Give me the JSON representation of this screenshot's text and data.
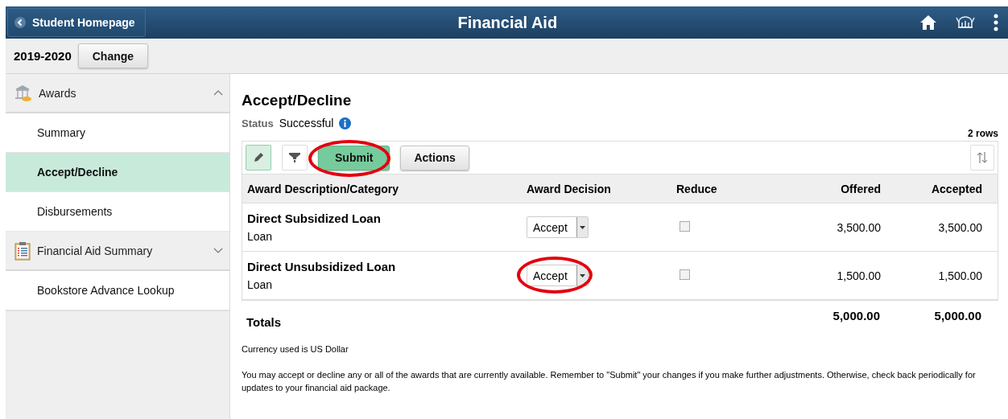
{
  "header": {
    "back_label": "Student Homepage",
    "title": "Financial Aid"
  },
  "aid_year": {
    "value": "2019-2020",
    "button": "Change"
  },
  "sidebar": {
    "items": [
      {
        "kind": "group",
        "label": "Awards",
        "expanded": true
      },
      {
        "kind": "link",
        "label": "Summary",
        "selected": false
      },
      {
        "kind": "link",
        "label": "Accept/Decline",
        "selected": true
      },
      {
        "kind": "link",
        "label": "Disbursements",
        "selected": false
      },
      {
        "kind": "group",
        "label": "Financial Aid Summary",
        "expanded": false
      },
      {
        "kind": "link",
        "label": "Bookstore Advance Lookup",
        "selected": false
      }
    ]
  },
  "page": {
    "title": "Accept/Decline",
    "status_label": "Status",
    "status_value": "Successful",
    "row_count": "2 rows"
  },
  "toolbar": {
    "submit": {
      "label": "Submit",
      "highlighted": true
    },
    "actions": {
      "label": "Actions"
    }
  },
  "table": {
    "columns": [
      "Award Description/Category",
      "Award Decision",
      "Reduce",
      "Offered",
      "Accepted"
    ],
    "rows": [
      {
        "description": "Direct Subsidized Loan",
        "category": "Loan",
        "decision": "Accept",
        "decision_highlighted": false,
        "reduce": false,
        "offered": "3,500.00",
        "accepted": "3,500.00"
      },
      {
        "description": "Direct Unsubsidized Loan",
        "category": "Loan",
        "decision": "Accept",
        "decision_highlighted": true,
        "reduce": false,
        "offered": "1,500.00",
        "accepted": "1,500.00"
      }
    ],
    "totals": {
      "label": "Totals",
      "offered": "5,000.00",
      "accepted": "5,000.00"
    }
  },
  "notes": [
    "Currency used is US Dollar",
    "You may accept or decline any or all of the awards that are currently available. Remember to \"Submit\" your changes if you make further adjustments. Otherwise, check back periodically for updates to your financial aid package."
  ]
}
